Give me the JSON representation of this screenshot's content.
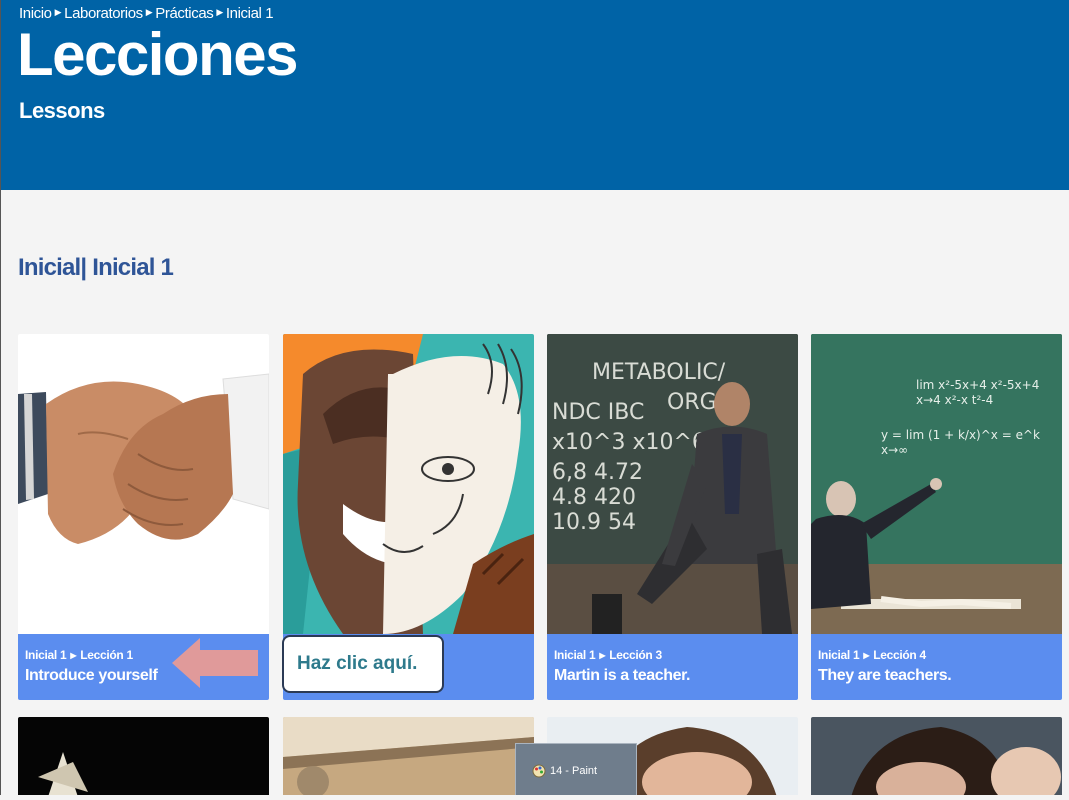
{
  "breadcrumb": [
    "Inicio",
    "Laboratorios",
    "Prácticas",
    "Inicial 1"
  ],
  "title": "Lecciones",
  "subtitle": "Lessons",
  "section_title": "Inicial| Inicial 1",
  "cards": [
    {
      "level": "Inicial 1",
      "lesson": "Lección 1",
      "title": "Introduce yourself",
      "image": "handshake"
    },
    {
      "level": "",
      "lesson": "",
      "title": "",
      "image": "face-collage"
    },
    {
      "level": "Inicial 1",
      "lesson": "Lección 3",
      "title": "Martin is a teacher.",
      "image": "man-at-chalkboard"
    },
    {
      "level": "Inicial 1",
      "lesson": "Lección 4",
      "title": "They are teachers.",
      "image": "teacher-pointing-at-board"
    }
  ],
  "callout": "Haz clic aquí.",
  "taskbar_preview": {
    "label": "14 - Paint",
    "icon": "paint-icon"
  },
  "colors": {
    "header": "#0063a6",
    "caption": "#5b8def",
    "section_title": "#2f5597",
    "callout_text": "#2e7a8c",
    "arrow": "#e09a9a"
  }
}
